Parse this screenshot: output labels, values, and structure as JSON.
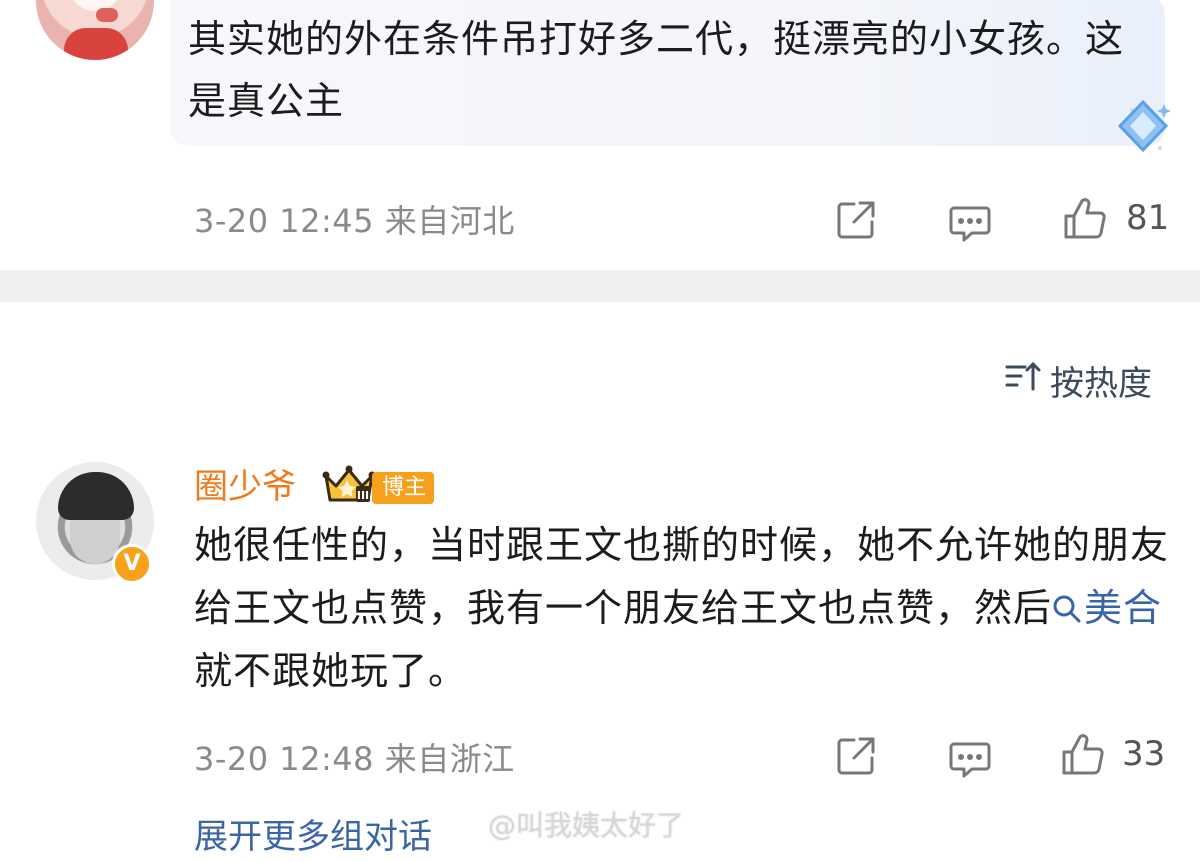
{
  "comment1": {
    "text": "其实她的外在条件吊打好多二代，挺漂亮的小女孩。这是真公主",
    "meta": "3-20 12:45 来自河北",
    "likes": "81",
    "icons": [
      "share-icon",
      "comment-icon",
      "like-icon"
    ]
  },
  "sort": {
    "label": "按热度",
    "icon": "sort-icon"
  },
  "comment2": {
    "username": "圈少爷",
    "badge": "博主",
    "text_part1": "她很任性的，当时跟王文也撕的时候，她不允许她的朋友给王文也点赞，我有一个朋友给王文也点赞，然后",
    "keyword": "美合",
    "text_part2": " 就不跟她玩了。",
    "meta": "3-20 12:48 来自浙江",
    "likes": "33",
    "verified_mark": "V"
  },
  "expand_label": "展开更多组对话",
  "watermark": "@叫我姨太好了",
  "colors": {
    "username": "#f07a1b",
    "link": "#3a63a8",
    "badge": "#f5a11e",
    "divider": "#f0f0f2"
  }
}
